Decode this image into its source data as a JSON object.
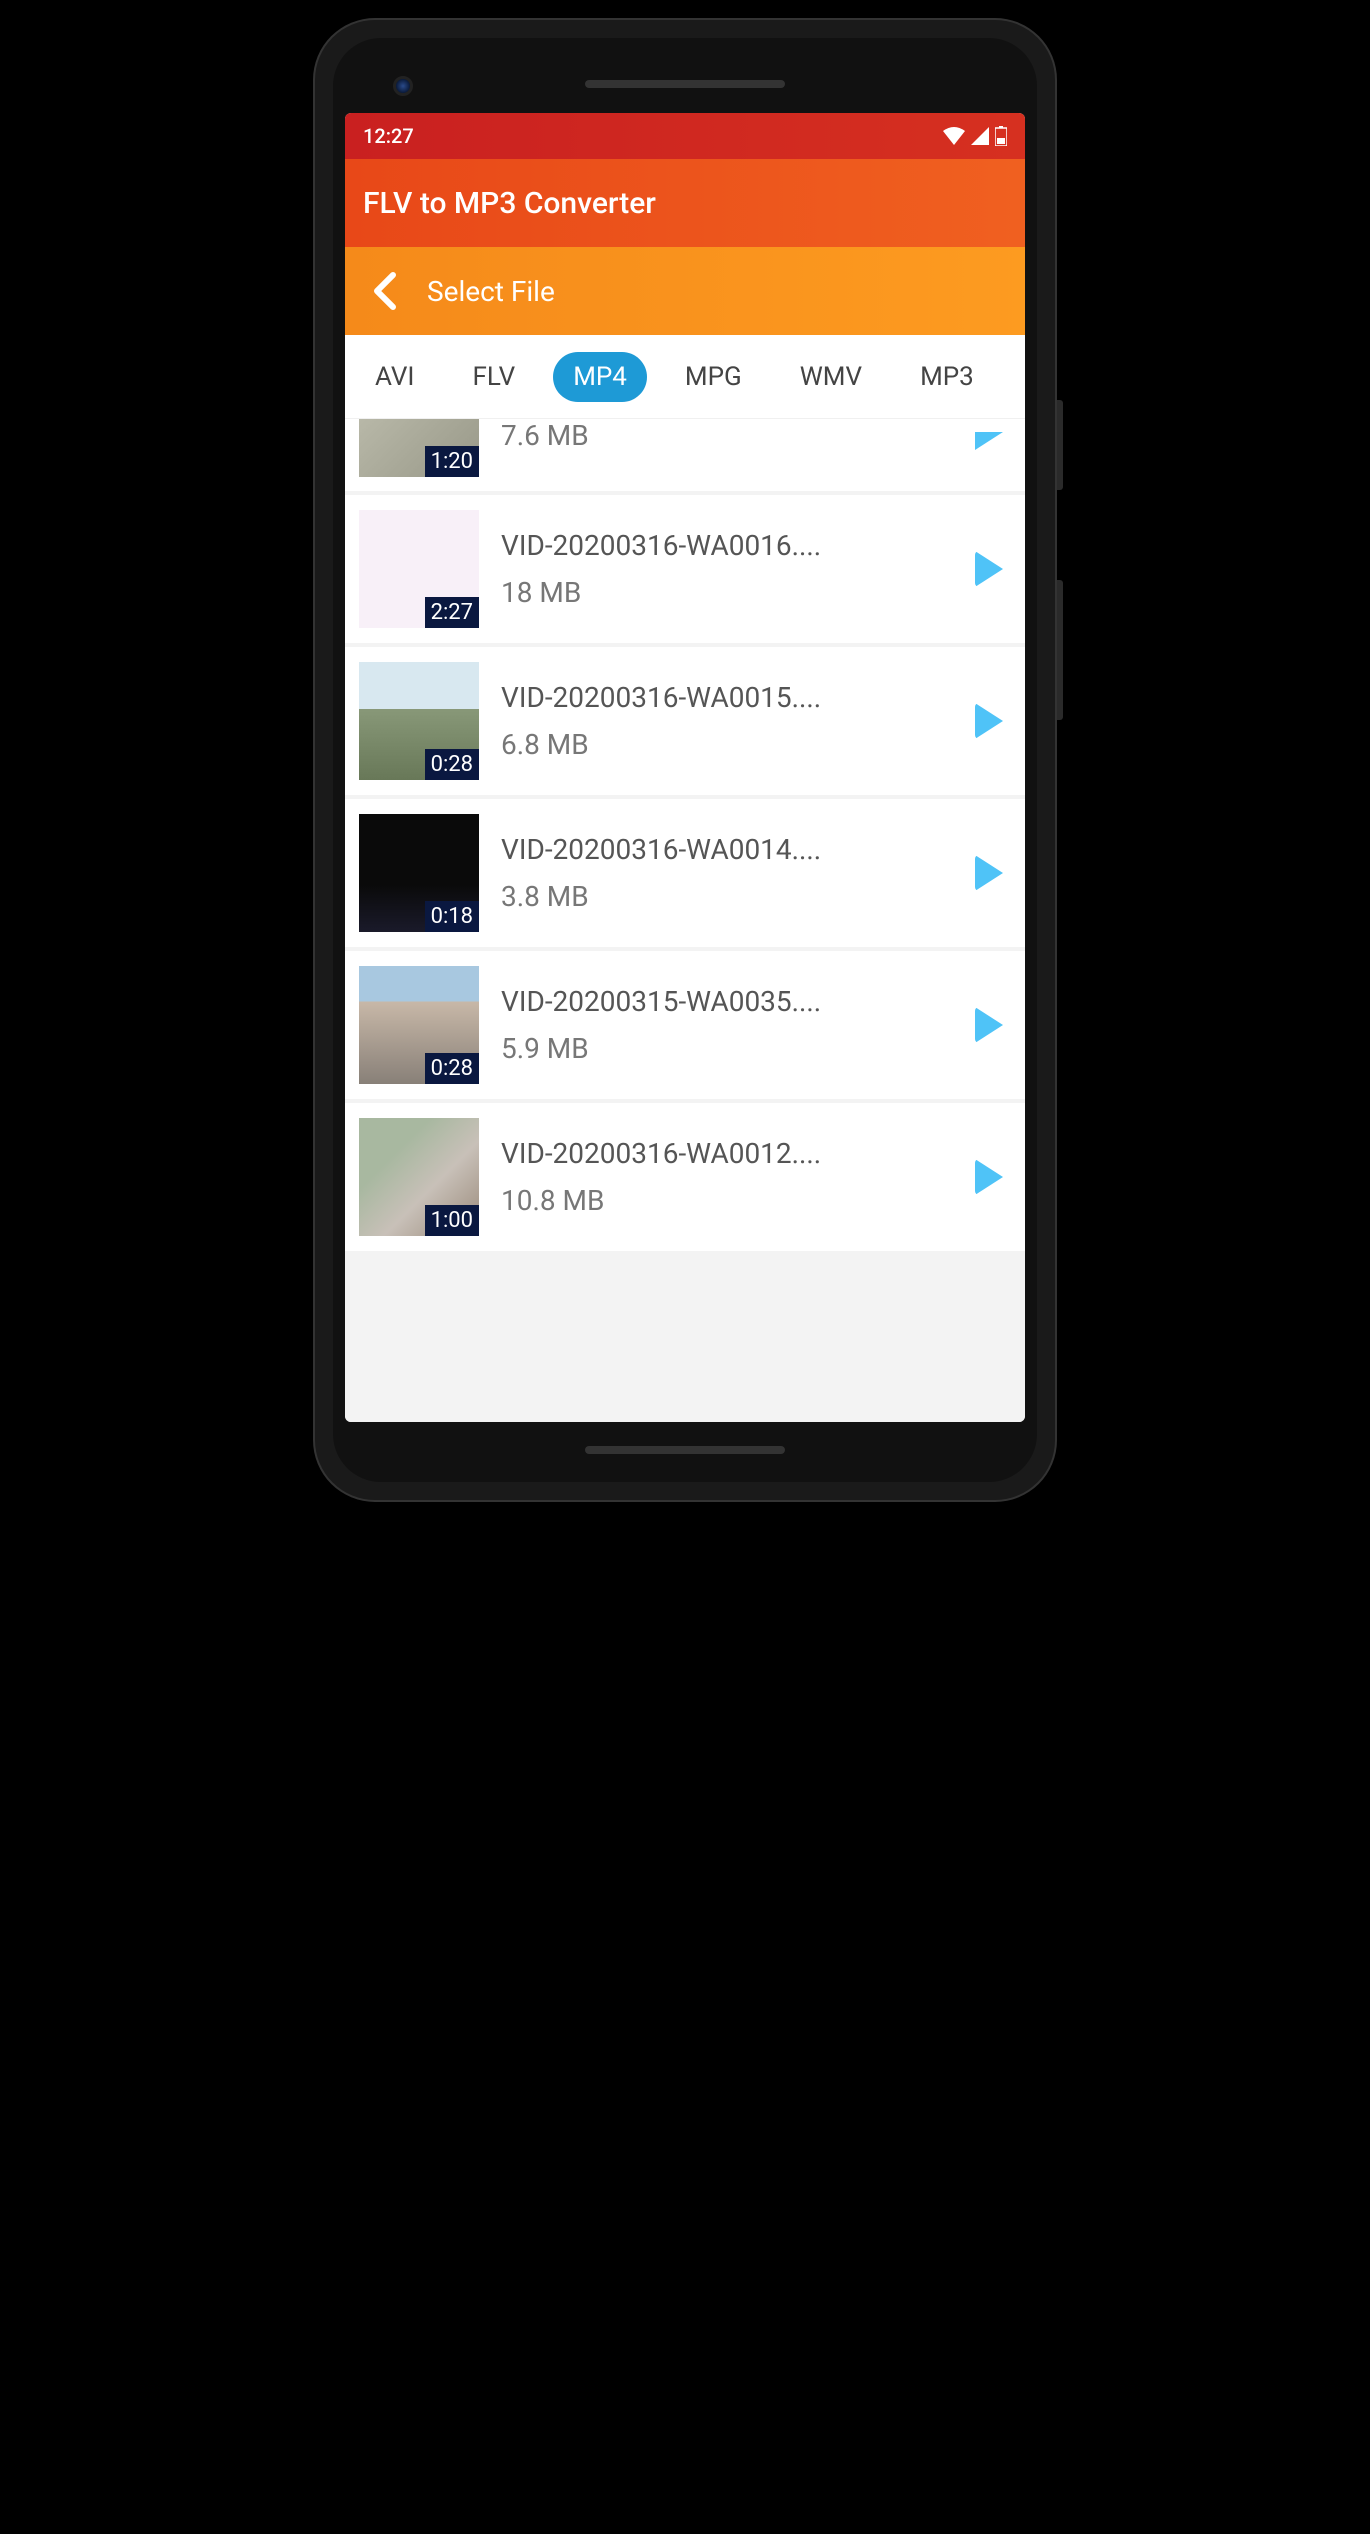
{
  "status": {
    "time": "12:27"
  },
  "header": {
    "title": "FLV to MP3 Converter"
  },
  "subheader": {
    "title": "Select File"
  },
  "filters": {
    "items": [
      {
        "label": "AVI",
        "active": false
      },
      {
        "label": "FLV",
        "active": false
      },
      {
        "label": "MP4",
        "active": true
      },
      {
        "label": "MPG",
        "active": false
      },
      {
        "label": "WMV",
        "active": false
      },
      {
        "label": "MP3",
        "active": false
      }
    ]
  },
  "files": [
    {
      "name": "",
      "size": "7.6 MB",
      "duration": "1:20",
      "partial": true
    },
    {
      "name": "VID-20200316-WA0016....",
      "size": "18 MB",
      "duration": "2:27"
    },
    {
      "name": "VID-20200316-WA0015....",
      "size": "6.8 MB",
      "duration": "0:28"
    },
    {
      "name": "VID-20200316-WA0014....",
      "size": "3.8 MB",
      "duration": "0:18"
    },
    {
      "name": "VID-20200315-WA0035....",
      "size": "5.9 MB",
      "duration": "0:28"
    },
    {
      "name": "VID-20200316-WA0012....",
      "size": "10.8 MB",
      "duration": "1:00"
    }
  ]
}
